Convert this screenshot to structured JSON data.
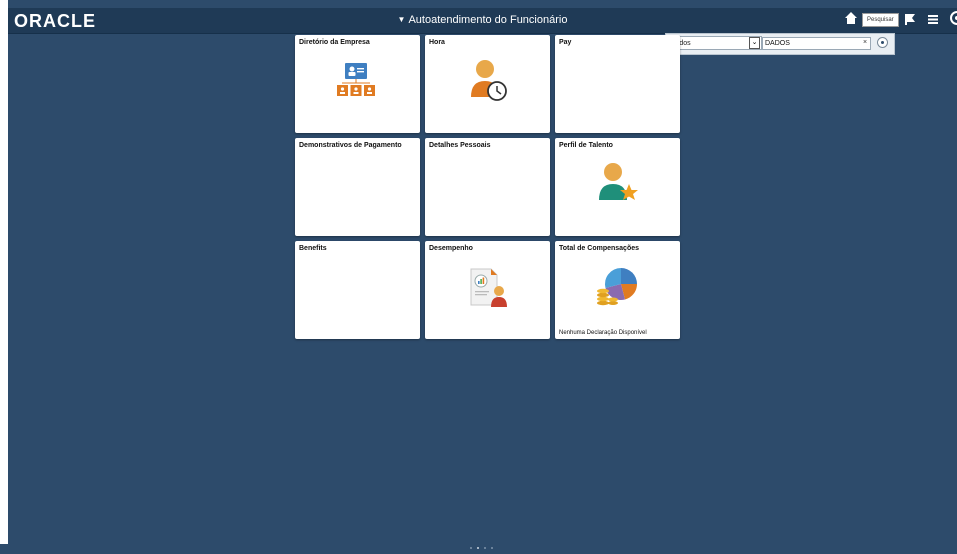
{
  "header": {
    "logo_text": "ORACLE",
    "title": "Autoatendimento do Funcionário",
    "search_tooltip": "Pesquisar"
  },
  "search": {
    "scope_selected": "Todos",
    "query_value": "DADOS",
    "clear_glyph": "×"
  },
  "tiles": [
    {
      "title": "Diretório da Empresa",
      "icon": "org-chart-icon"
    },
    {
      "title": "Hora",
      "icon": "person-clock-icon"
    },
    {
      "title": "Pay",
      "icon": ""
    },
    {
      "title": "Demonstrativos de Pagamento",
      "icon": ""
    },
    {
      "title": "Detalhes Pessoais",
      "icon": ""
    },
    {
      "title": "Perfil de Talento",
      "icon": "person-star-icon"
    },
    {
      "title": "Benefits",
      "icon": ""
    },
    {
      "title": "Desempenho",
      "icon": "performance-report-icon"
    },
    {
      "title": "Total de Compensações",
      "icon": "pie-coins-icon",
      "note": "Nenhuma Declaração Disponível"
    }
  ],
  "colors": {
    "background": "#2d4b6b",
    "topbar": "#1f3a56",
    "orange": "#e07b22",
    "blue": "#3f7fc1"
  },
  "pagination": {
    "pages": 4,
    "active": 1
  }
}
